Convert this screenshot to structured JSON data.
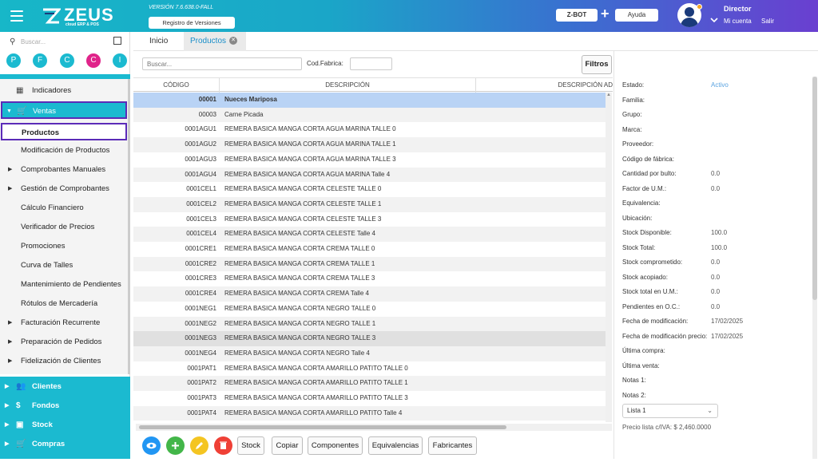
{
  "header": {
    "logo_text": "ZEUS",
    "logo_sub": "cloud ERP & POS",
    "version": "VERSIÓN 7.6.638.0-FALL",
    "registro_label": "Registro de Versiones",
    "zbot_label": "Z-BOT",
    "plus": "+",
    "ayuda_label": "Ayuda",
    "user_name": "Director",
    "mi_cuenta": "Mi cuenta",
    "salir": "Salir"
  },
  "sidebar": {
    "search_placeholder": "Buscar...",
    "shortcuts": [
      {
        "letter": "P",
        "color": "#1bbad0"
      },
      {
        "letter": "F",
        "color": "#1bbad0"
      },
      {
        "letter": "C",
        "color": "#1bbad0"
      },
      {
        "letter": "C",
        "color": "#e0248a"
      },
      {
        "letter": "I",
        "color": "#1bbad0"
      }
    ],
    "menu": [
      {
        "label": "Indicadores"
      },
      {
        "label": "Ventas"
      },
      {
        "label": "Productos"
      },
      {
        "label": "Modificación de Productos"
      },
      {
        "label": "Comprobantes Manuales"
      },
      {
        "label": "Gestión de Comprobantes"
      },
      {
        "label": "Cálculo Financiero"
      },
      {
        "label": "Verificador de Precios"
      },
      {
        "label": "Promociones"
      },
      {
        "label": "Curva de Talles"
      },
      {
        "label": "Mantenimiento de Pendientes"
      },
      {
        "label": "Rótulos de Mercadería"
      },
      {
        "label": "Facturación Recurrente"
      },
      {
        "label": "Preparación de Pedidos"
      },
      {
        "label": "Fidelización de Clientes"
      }
    ],
    "bottom": [
      {
        "label": "Clientes"
      },
      {
        "label": "Fondos"
      },
      {
        "label": "Stock"
      },
      {
        "label": "Compras"
      }
    ]
  },
  "tabs": [
    {
      "label": "Inicio"
    },
    {
      "label": "Productos"
    }
  ],
  "filters": {
    "buscar_placeholder": "Buscar...",
    "codfab_label": "Cod.Fabrica:",
    "filtros_label": "Filtros"
  },
  "table": {
    "columns": [
      "CÓDIGO",
      "DESCRIPCIÓN",
      "DESCRIPCIÓN AD"
    ],
    "rows": [
      {
        "code": "00001",
        "desc": "Nueces Mariposa"
      },
      {
        "code": "00003",
        "desc": "Carne Picada"
      },
      {
        "code": "0001AGU1",
        "desc": "REMERA BASICA MANGA CORTA AGUA MARINA TALLE 0"
      },
      {
        "code": "0001AGU2",
        "desc": "REMERA BASICA MANGA CORTA AGUA MARINA TALLE 1"
      },
      {
        "code": "0001AGU3",
        "desc": "REMERA BASICA MANGA CORTA AGUA MARINA TALLE 3"
      },
      {
        "code": "0001AGU4",
        "desc": "REMERA BASICA MANGA CORTA AGUA MARINA Talle 4"
      },
      {
        "code": "0001CEL1",
        "desc": "REMERA BASICA MANGA CORTA CELESTE TALLE 0"
      },
      {
        "code": "0001CEL2",
        "desc": "REMERA BASICA MANGA CORTA CELESTE TALLE 1"
      },
      {
        "code": "0001CEL3",
        "desc": "REMERA BASICA MANGA CORTA CELESTE TALLE 3"
      },
      {
        "code": "0001CEL4",
        "desc": "REMERA BASICA MANGA CORTA CELESTE Talle 4"
      },
      {
        "code": "0001CRE1",
        "desc": "REMERA BASICA MANGA CORTA CREMA TALLE 0"
      },
      {
        "code": "0001CRE2",
        "desc": "REMERA BASICA MANGA CORTA CREMA TALLE 1"
      },
      {
        "code": "0001CRE3",
        "desc": "REMERA BASICA MANGA CORTA CREMA TALLE 3"
      },
      {
        "code": "0001CRE4",
        "desc": "REMERA BASICA MANGA CORTA CREMA Talle 4"
      },
      {
        "code": "0001NEG1",
        "desc": "REMERA BASICA MANGA CORTA NEGRO TALLE 0"
      },
      {
        "code": "0001NEG2",
        "desc": "REMERA BASICA MANGA CORTA NEGRO TALLE 1"
      },
      {
        "code": "0001NEG3",
        "desc": "REMERA BASICA MANGA CORTA NEGRO TALLE 3"
      },
      {
        "code": "0001NEG4",
        "desc": "REMERA BASICA MANGA CORTA NEGRO Talle 4"
      },
      {
        "code": "0001PAT1",
        "desc": "REMERA BASICA MANGA CORTA AMARILLO PATITO TALLE 0"
      },
      {
        "code": "0001PAT2",
        "desc": "REMERA BASICA MANGA CORTA AMARILLO PATITO TALLE 1"
      },
      {
        "code": "0001PAT3",
        "desc": "REMERA BASICA MANGA CORTA AMARILLO PATITO TALLE 3"
      },
      {
        "code": "0001PAT4",
        "desc": "REMERA BASICA MANGA CORTA AMARILLO PATITO Talle 4"
      }
    ]
  },
  "toolbar": {
    "round_buttons": [
      {
        "icon": "eye-icon",
        "color": "#2196f3"
      },
      {
        "icon": "plus-icon",
        "color": "#43b649"
      },
      {
        "icon": "pencil-icon",
        "color": "#f4c522"
      },
      {
        "icon": "trash-icon",
        "color": "#ef4036"
      }
    ],
    "buttons": [
      "Stock",
      "Copiar",
      "Componentes",
      "Equivalencias",
      "Fabricantes"
    ]
  },
  "detail": {
    "fields": [
      {
        "label": "Estado:",
        "value": "Activo"
      },
      {
        "label": "Familia:",
        "value": ""
      },
      {
        "label": "Grupo:",
        "value": ""
      },
      {
        "label": "Marca:",
        "value": ""
      },
      {
        "label": "Proveedor:",
        "value": ""
      },
      {
        "label": "Código de fábrica:",
        "value": ""
      },
      {
        "label": "Cantidad por bulto:",
        "value": "0.0"
      },
      {
        "label": "Factor de U.M.:",
        "value": "0.0"
      },
      {
        "label": "Equivalencia:",
        "value": ""
      },
      {
        "label": "Ubicación:",
        "value": ""
      },
      {
        "label": "Stock Disponible:",
        "value": "100.0"
      },
      {
        "label": "Stock Total:",
        "value": "100.0"
      },
      {
        "label": "Stock comprometido:",
        "value": "0.0"
      },
      {
        "label": "Stock acopiado:",
        "value": "0.0"
      },
      {
        "label": "Stock total en U.M.:",
        "value": "0.0"
      },
      {
        "label": "Pendientes en O.C.:",
        "value": "0.0"
      },
      {
        "label": "Fecha de modificación:",
        "value": "17/02/2025"
      },
      {
        "label": "Fecha de modificación precio:",
        "value": "17/02/2025"
      },
      {
        "label": "Última compra:",
        "value": ""
      },
      {
        "label": "Última venta:",
        "value": ""
      },
      {
        "label": "Notas 1:",
        "value": ""
      },
      {
        "label": "Notas 2:",
        "value": ""
      }
    ],
    "lista_value": "Lista 1",
    "precio_text": "Precio lista c/IVA: $ 2,460.0000"
  }
}
